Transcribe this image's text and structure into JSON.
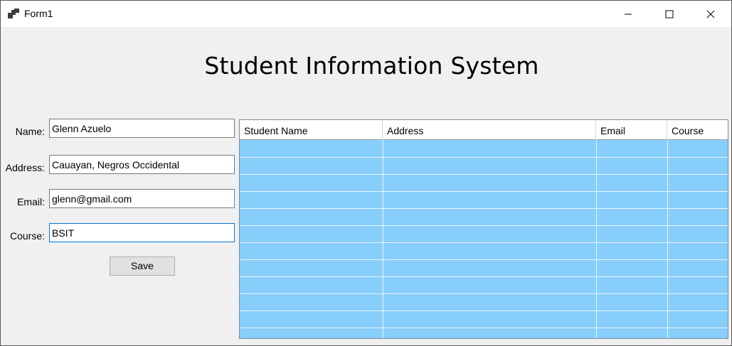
{
  "window": {
    "title": "Form1",
    "controls": {
      "minimize": "minimize-icon",
      "maximize": "maximize-icon",
      "close": "close-icon"
    }
  },
  "form": {
    "heading": "Student Information System",
    "fields": {
      "name": {
        "label": "Name:",
        "value": "Glenn Azuelo"
      },
      "address": {
        "label": "Address:",
        "value": "Cauayan, Negros Occidental"
      },
      "email": {
        "label": "Email:",
        "value": "glenn@gmail.com"
      },
      "course": {
        "label": "Course:",
        "value": "BSIT"
      }
    },
    "save_label": "Save"
  },
  "grid": {
    "columns": [
      "Student Name",
      "Address",
      "Email",
      "Course"
    ],
    "row_color": "#87cefa",
    "rows": []
  }
}
